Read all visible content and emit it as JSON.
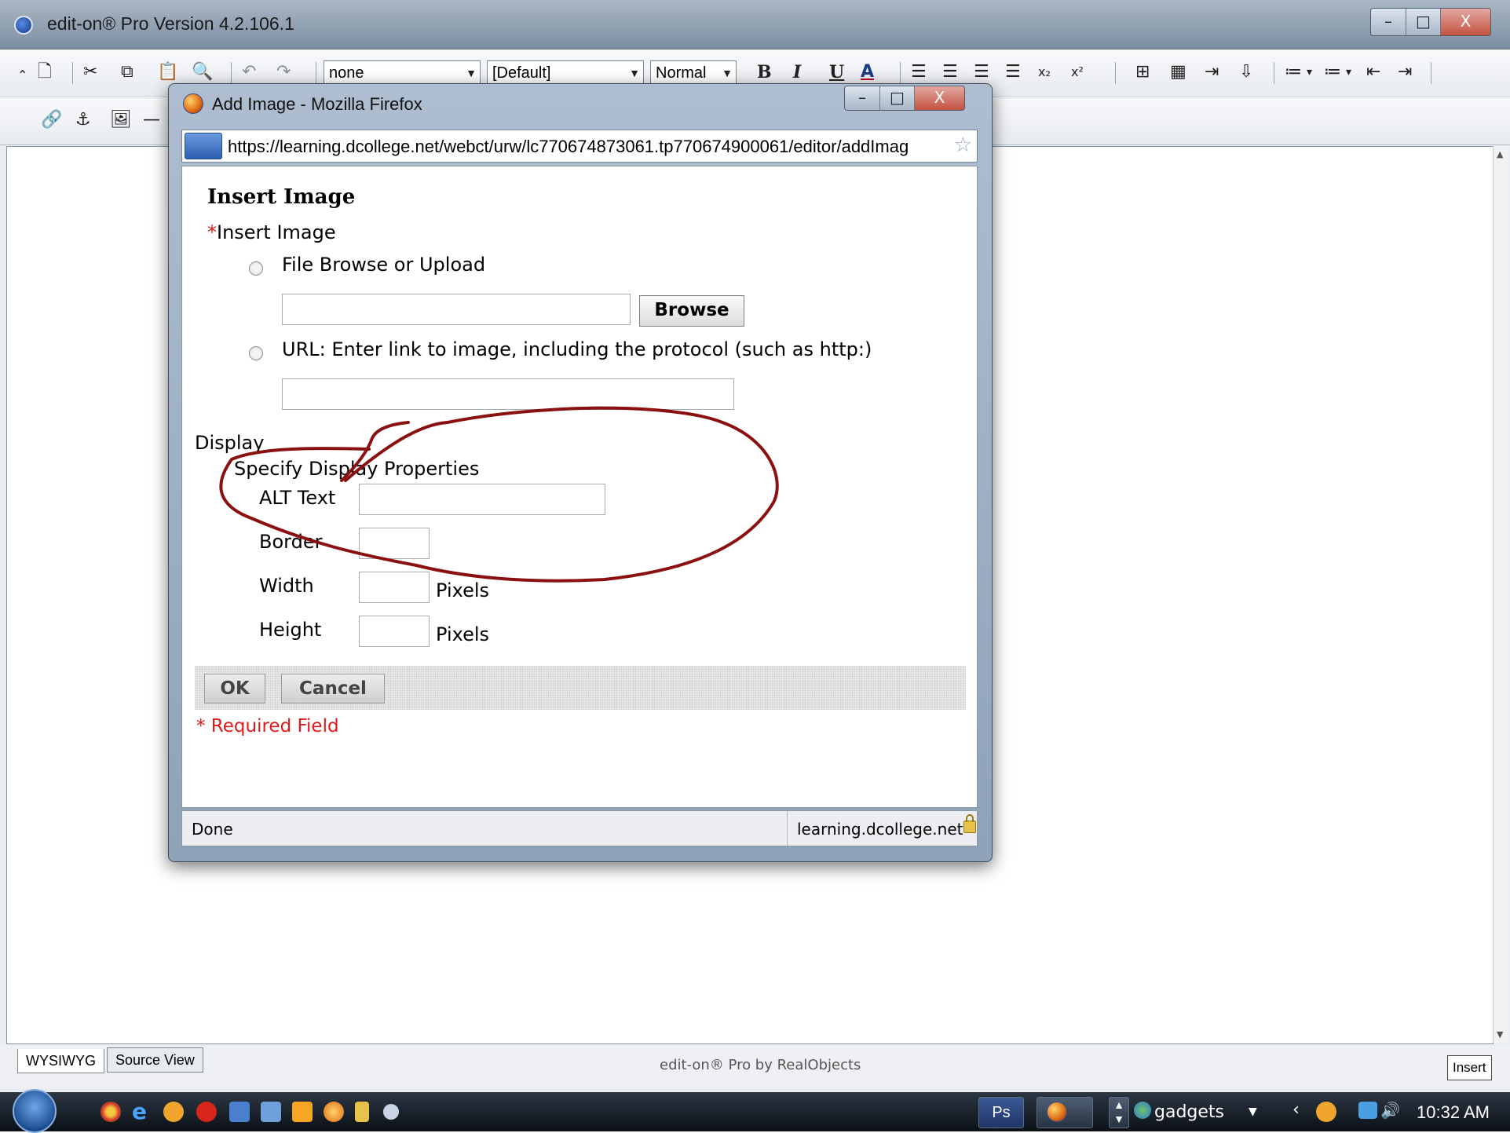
{
  "editor": {
    "title": "edit-on® Pro Version 4.2.106.1",
    "toolbar": {
      "font_select": "none",
      "size_select": "[Default]",
      "style_select": "Normal",
      "bold": "B",
      "italic": "I",
      "underline": "U",
      "font_color": "A"
    },
    "footer": {
      "tab_wysiwyg": "WYSIWYG",
      "tab_source": "Source View",
      "credit": "edit-on® Pro by RealObjects",
      "mode": "Insert"
    },
    "window_controls": {
      "minimize": "–",
      "maximize": "□",
      "close": "X"
    }
  },
  "dialog": {
    "title": "Add Image - Mozilla Firefox",
    "url": "https://learning.dcollege.net/webct/urw/lc770674873061.tp770674900061/editor/addImag",
    "status": "Done",
    "status_domain": "learning.dcollege.net",
    "window_controls": {
      "minimize": "–",
      "maximize": "□",
      "close": "X"
    },
    "form": {
      "heading": "Insert Image",
      "required_marker": "*",
      "insert_label": "Insert Image",
      "option_file": "File Browse or Upload",
      "browse_button": "Browse",
      "option_url": "URL: Enter link to image, including the protocol (such as http:)",
      "display_label": "Display",
      "display_subheading": "Specify Display Properties",
      "alt_text_label": "ALT Text",
      "border_label": "Border",
      "width_label": "Width",
      "height_label": "Height",
      "pixels_unit": "Pixels",
      "ok_button": "OK",
      "cancel_button": "Cancel",
      "required_note": "* Required Field"
    }
  },
  "taskbar": {
    "tray_gadgets": "gadgets",
    "clock": "10:32 AM",
    "ps_button": "Ps"
  },
  "colors": {
    "required_red": "#e0191c",
    "annotation_red": "#8b1010"
  }
}
